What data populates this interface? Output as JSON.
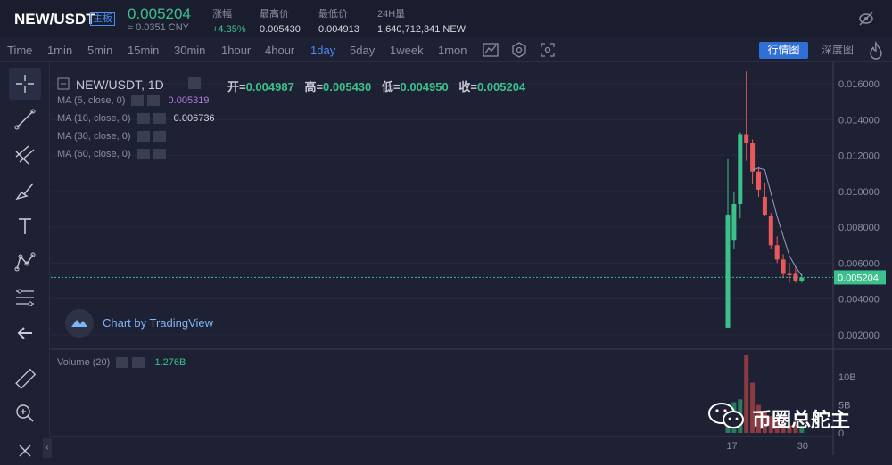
{
  "header": {
    "pair": "NEW/USDT",
    "board_tag": "主板",
    "price": "0.005204",
    "price_cny": "≈ 0.0351 CNY",
    "stats": [
      {
        "label": "涨幅",
        "value": "+4.35%",
        "color": "#3cc08c"
      },
      {
        "label": "最高价",
        "value": "0.005430"
      },
      {
        "label": "最低价",
        "value": "0.004913"
      },
      {
        "label": "24H量",
        "value": "1,640,712,341 NEW"
      }
    ]
  },
  "toolbar": {
    "timeframes": [
      "Time",
      "1min",
      "5min",
      "15min",
      "30min",
      "1hour",
      "4hour",
      "1day",
      "5day",
      "1week",
      "1mon"
    ],
    "active_timeframe": "1day",
    "market_button": "行情图",
    "depth_button": "深度图"
  },
  "legend": {
    "title": "NEW/USDT, 1D",
    "ohlc": [
      {
        "k": "开=",
        "v": "0.004987"
      },
      {
        "k": "高=",
        "v": "0.005430"
      },
      {
        "k": "低=",
        "v": "0.004950"
      },
      {
        "k": "收=",
        "v": "0.005204"
      }
    ],
    "ma": [
      {
        "label": "MA (5, close, 0)",
        "value": "0.005319",
        "color": "#b07ce0"
      },
      {
        "label": "MA (10, close, 0)",
        "value": "0.006736",
        "color": "#d5d7e0"
      },
      {
        "label": "MA (30, close, 0)",
        "value": ""
      },
      {
        "label": "MA (60, close, 0)",
        "value": ""
      }
    ],
    "volume_label": "Volume (20)",
    "volume_value": "1.276B"
  },
  "branding": {
    "chart_by": "Chart by TradingView",
    "watermark": "币圈总舵主"
  },
  "colors": {
    "up": "#3cc08c",
    "down": "#e9595b",
    "accent": "#4a8cf0",
    "bg": "#1e2133"
  },
  "chart_data": {
    "type": "candlestick",
    "y_ticks": [
      "0.016000",
      "0.014000",
      "0.012000",
      "0.010000",
      "0.008000",
      "0.006000",
      "0.004000",
      "0.002000"
    ],
    "price_tag": "0.005204",
    "volume_ticks": [
      "10B",
      "5B",
      "0"
    ],
    "x_ticks": [
      "17",
      "30"
    ],
    "ylim": [
      0.0013,
      0.0172
    ],
    "candles": [
      {
        "o": 0.0024,
        "h": 0.0118,
        "l": 0.0024,
        "c": 0.0087,
        "up": true
      },
      {
        "o": 0.0073,
        "h": 0.01,
        "l": 0.0068,
        "c": 0.0093,
        "up": true
      },
      {
        "o": 0.0093,
        "h": 0.0133,
        "l": 0.0085,
        "c": 0.0132,
        "up": true
      },
      {
        "o": 0.0132,
        "h": 0.0167,
        "l": 0.0117,
        "c": 0.0127,
        "up": false
      },
      {
        "o": 0.0127,
        "h": 0.0129,
        "l": 0.0104,
        "c": 0.0111,
        "up": false
      },
      {
        "o": 0.0111,
        "h": 0.0114,
        "l": 0.0097,
        "c": 0.0101,
        "up": false
      },
      {
        "o": 0.0097,
        "h": 0.0105,
        "l": 0.0086,
        "c": 0.0087,
        "up": false
      },
      {
        "o": 0.0086,
        "h": 0.0088,
        "l": 0.0068,
        "c": 0.007,
        "up": false
      },
      {
        "o": 0.007,
        "h": 0.0075,
        "l": 0.006,
        "c": 0.0062,
        "up": false
      },
      {
        "o": 0.0062,
        "h": 0.0065,
        "l": 0.0052,
        "c": 0.0054,
        "up": false
      },
      {
        "o": 0.0054,
        "h": 0.006,
        "l": 0.0049,
        "c": 0.0054,
        "up": false
      },
      {
        "o": 0.0054,
        "h": 0.0058,
        "l": 0.0049,
        "c": 0.005,
        "up": false
      },
      {
        "o": 0.005,
        "h": 0.0054,
        "l": 0.0049,
        "c": 0.0052,
        "up": true
      }
    ],
    "volumes": [
      {
        "v": 2.0,
        "up": true
      },
      {
        "v": 5.5,
        "up": true
      },
      {
        "v": 6.0,
        "up": true
      },
      {
        "v": 14.0,
        "up": false
      },
      {
        "v": 9.0,
        "up": false
      },
      {
        "v": 5.0,
        "up": false
      },
      {
        "v": 4.0,
        "up": false
      },
      {
        "v": 3.0,
        "up": false
      },
      {
        "v": 2.0,
        "up": false
      },
      {
        "v": 1.8,
        "up": false
      },
      {
        "v": 1.4,
        "up": false
      },
      {
        "v": 1.6,
        "up": false
      },
      {
        "v": 1.276,
        "up": true
      }
    ],
    "vol_max": 14.5,
    "ma5": [
      null,
      null,
      null,
      null,
      0.0112,
      0.0113,
      0.0112,
      0.0099,
      0.0086,
      0.0075,
      0.0064,
      0.0058,
      0.0053
    ]
  }
}
